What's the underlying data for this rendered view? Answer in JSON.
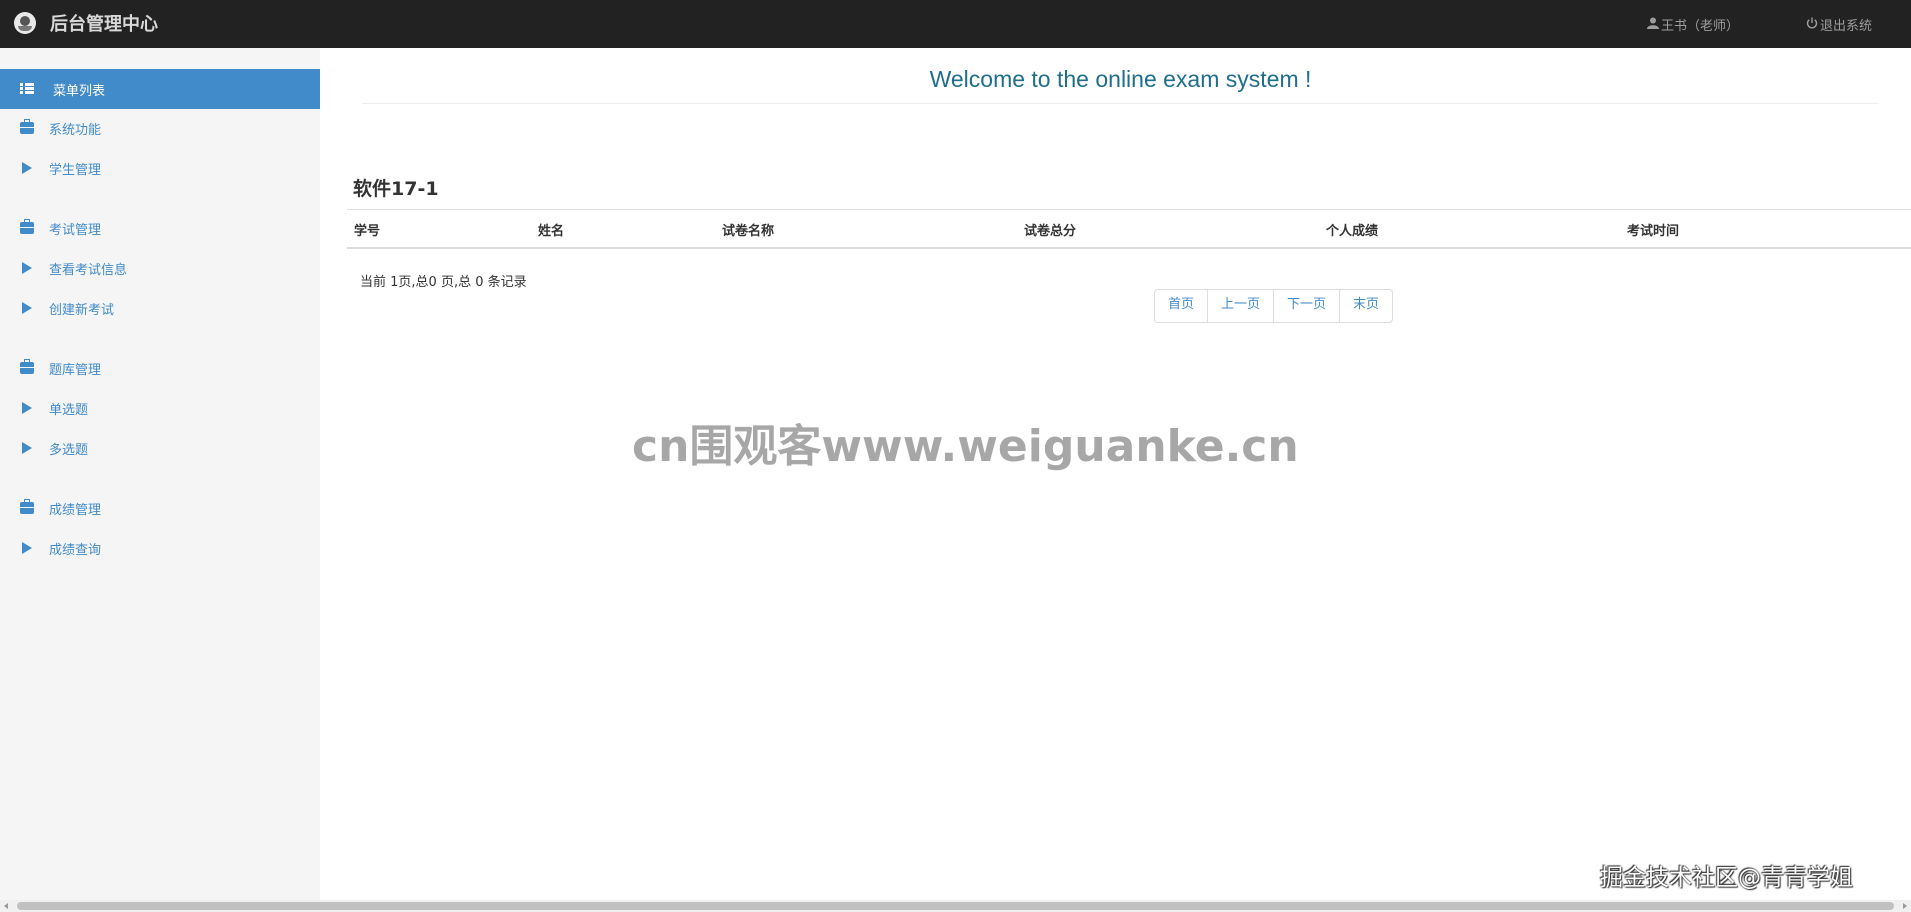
{
  "navbar": {
    "title": "后台管理中心",
    "user_label": "王书（老师）",
    "logout_label": "退出系统"
  },
  "sidebar": {
    "header_label": "菜单列表",
    "items": [
      {
        "label": "系统功能",
        "icon": "briefcase-icon"
      },
      {
        "label": "学生管理",
        "icon": "triangle-right-icon"
      },
      {
        "label": "考试管理",
        "icon": "briefcase-icon"
      },
      {
        "label": "查看考试信息",
        "icon": "triangle-right-icon"
      },
      {
        "label": "创建新考试",
        "icon": "triangle-right-icon"
      },
      {
        "label": "题库管理",
        "icon": "briefcase-icon"
      },
      {
        "label": "单选题",
        "icon": "triangle-right-icon"
      },
      {
        "label": "多选题",
        "icon": "triangle-right-icon"
      },
      {
        "label": "成绩管理",
        "icon": "briefcase-icon"
      },
      {
        "label": "成绩查询",
        "icon": "triangle-right-icon"
      }
    ]
  },
  "main": {
    "welcome": "Welcome to the online exam system !",
    "class_title": "软件17-1",
    "table": {
      "columns": [
        "学号",
        "姓名",
        "试卷名称",
        "试卷总分",
        "个人成绩",
        "考试时间"
      ],
      "rows": []
    },
    "page_info": "当前 1页,总0 页,总 0 条记录",
    "pager": {
      "first": "首页",
      "prev": "上一页",
      "next": "下一页",
      "last": "末页"
    }
  },
  "overlay": {
    "watermark": "cn围观客www.weiguanke.cn",
    "signature": "掘金技术社区@青青学姐"
  },
  "colors": {
    "navbar_bg": "#222222",
    "accent": "#428bca",
    "welcome_text": "#1f6e8c",
    "sidebar_bg": "#f5f5f5"
  }
}
